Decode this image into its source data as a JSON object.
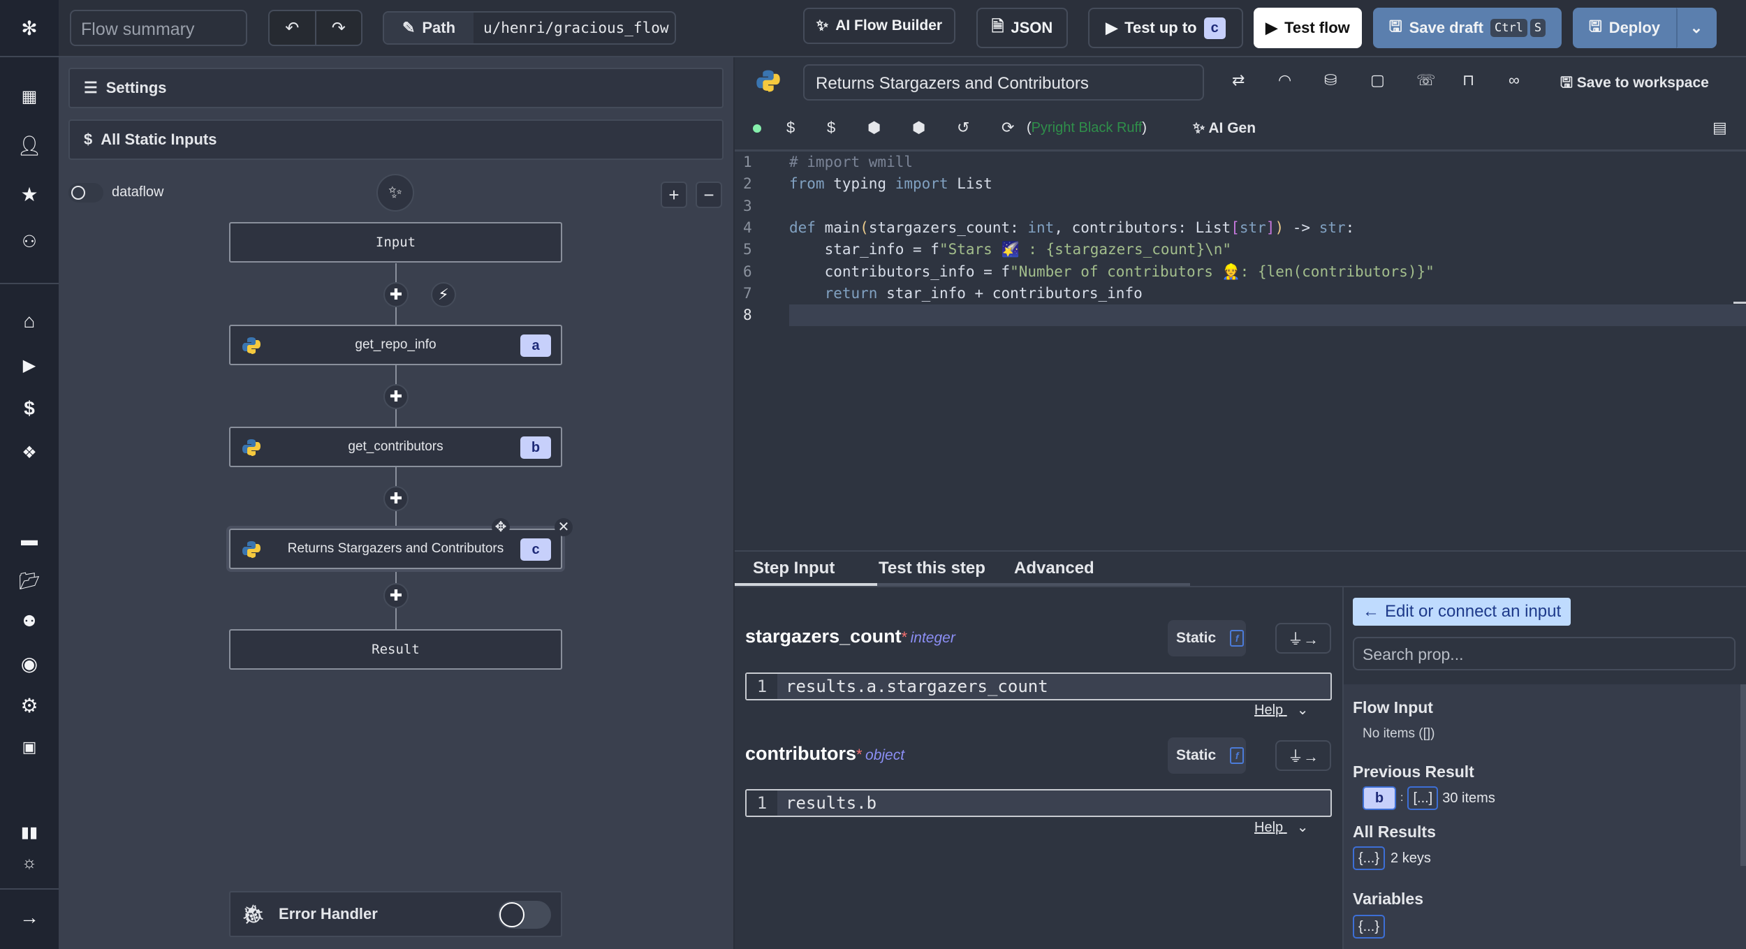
{
  "topbar": {
    "flow_summary_placeholder": "Flow summary",
    "path_label": "Path",
    "path_value": "u/henri/gracious_flow",
    "ai_flow_builder": "AI Flow Builder",
    "json": "JSON",
    "test_up_to": "Test up to",
    "test_up_to_badge": "c",
    "test_flow": "Test flow",
    "save_draft": "Save draft",
    "shortcut_ctrl": "Ctrl",
    "shortcut_s": "S",
    "deploy": "Deploy"
  },
  "flow": {
    "settings": "Settings",
    "static_inputs": "All Static Inputs",
    "dataflow_label": "dataflow",
    "dataflow_on": false,
    "nodes": [
      {
        "label": "Input"
      },
      {
        "label": "get_repo_info",
        "badge": "a"
      },
      {
        "label": "get_contributors",
        "badge": "b"
      },
      {
        "label": "Returns Stargazers and Contributors",
        "badge": "c"
      },
      {
        "label": "Result"
      }
    ],
    "error_handler": "Error Handler",
    "error_handler_on": false
  },
  "editor": {
    "step_name": "Returns Stargazers and Contributors",
    "save_to_workspace": "Save to workspace",
    "lint_open": "(",
    "lint_tools": "Pyright Black Ruff",
    "lint_close": ")",
    "ai_gen": "AI Gen",
    "line_numbers": [
      "1",
      "2",
      "3",
      "4",
      "5",
      "6",
      "7",
      "8"
    ]
  },
  "step_panel": {
    "tabs": [
      "Step Input",
      "Test this step",
      "Advanced"
    ],
    "active_tab": 0,
    "inputs": [
      {
        "name": "stargazers_count",
        "required": "*",
        "type": "integer",
        "mode": "Static",
        "expr_line": "1",
        "expr": "results.a.stargazers_count",
        "help": "Help"
      },
      {
        "name": "contributors",
        "required": "*",
        "type": "object",
        "mode": "Static",
        "expr_line": "1",
        "expr": "results.b",
        "help": "Help"
      }
    ]
  },
  "props": {
    "edit_button": "Edit or connect an input",
    "search_placeholder": "Search prop...",
    "flow_input": "Flow Input",
    "no_items": "No items ([])",
    "previous_result": "Previous Result",
    "prev_badge": "b",
    "prev_colon": ":",
    "prev_array": "[...]",
    "prev_count": "30 items",
    "all_results": "All Results",
    "all_obj": "{...}",
    "all_count": "2 keys",
    "variables": "Variables",
    "var_obj": "{...}"
  },
  "colors": {
    "accent": "#c7d0fb",
    "deploy": "#5b7fae",
    "edit_button": "#bfdbfe",
    "lint_green": "#2f8f4a",
    "status_dot": "#86efac"
  }
}
